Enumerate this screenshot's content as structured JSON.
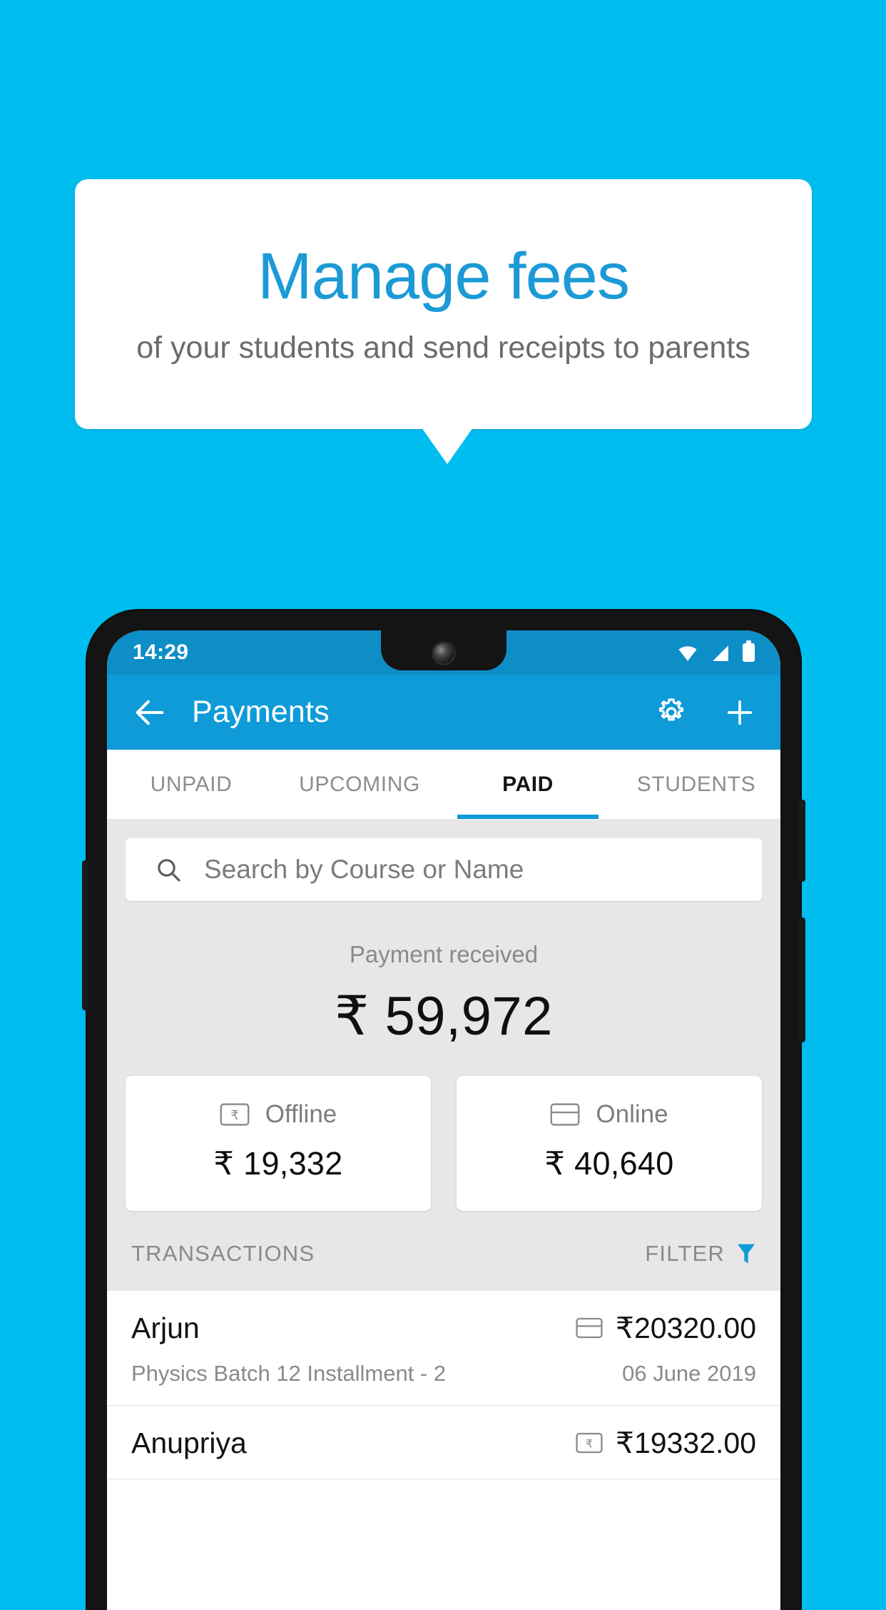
{
  "promo": {
    "title": "Manage fees",
    "subtitle": "of your students and send receipts to parents",
    "title_color": "#1b9ad6",
    "background_color": "#00bdef"
  },
  "phone": {
    "status_bar": {
      "time": "14:29",
      "icons": [
        "wifi-icon",
        "signal-icon",
        "battery-icon"
      ],
      "background_color": "#0d8ec7"
    },
    "app_bar": {
      "back_icon": "arrow-left-icon",
      "title": "Payments",
      "settings_icon": "gear-icon",
      "add_icon": "plus-icon",
      "background_color": "#0e9bd8"
    },
    "tabs": [
      {
        "label": "UNPAID",
        "active": false
      },
      {
        "label": "UPCOMING",
        "active": false
      },
      {
        "label": "PAID",
        "active": true
      },
      {
        "label": "STUDENTS",
        "active": false
      }
    ],
    "search": {
      "icon": "search-icon",
      "placeholder": "Search by Course or Name",
      "value": ""
    },
    "summary": {
      "label": "Payment received",
      "amount": "₹ 59,972"
    },
    "payment_modes": [
      {
        "icon": "rupee-note-icon",
        "label": "Offline",
        "amount": "₹ 19,332"
      },
      {
        "icon": "credit-card-icon",
        "label": "Online",
        "amount": "₹ 40,640"
      }
    ],
    "transactions_header": {
      "title": "TRANSACTIONS",
      "filter_label": "FILTER",
      "filter_icon": "funnel-icon",
      "filter_color": "#0e9bd8"
    },
    "transactions": [
      {
        "name": "Arjun",
        "mode_icon": "credit-card-icon",
        "amount": "₹20320.00",
        "description": "Physics Batch 12 Installment - 2",
        "date": "06 June 2019"
      },
      {
        "name": "Anupriya",
        "mode_icon": "rupee-note-icon",
        "amount": "₹19332.00",
        "description": "",
        "date": ""
      }
    ]
  }
}
